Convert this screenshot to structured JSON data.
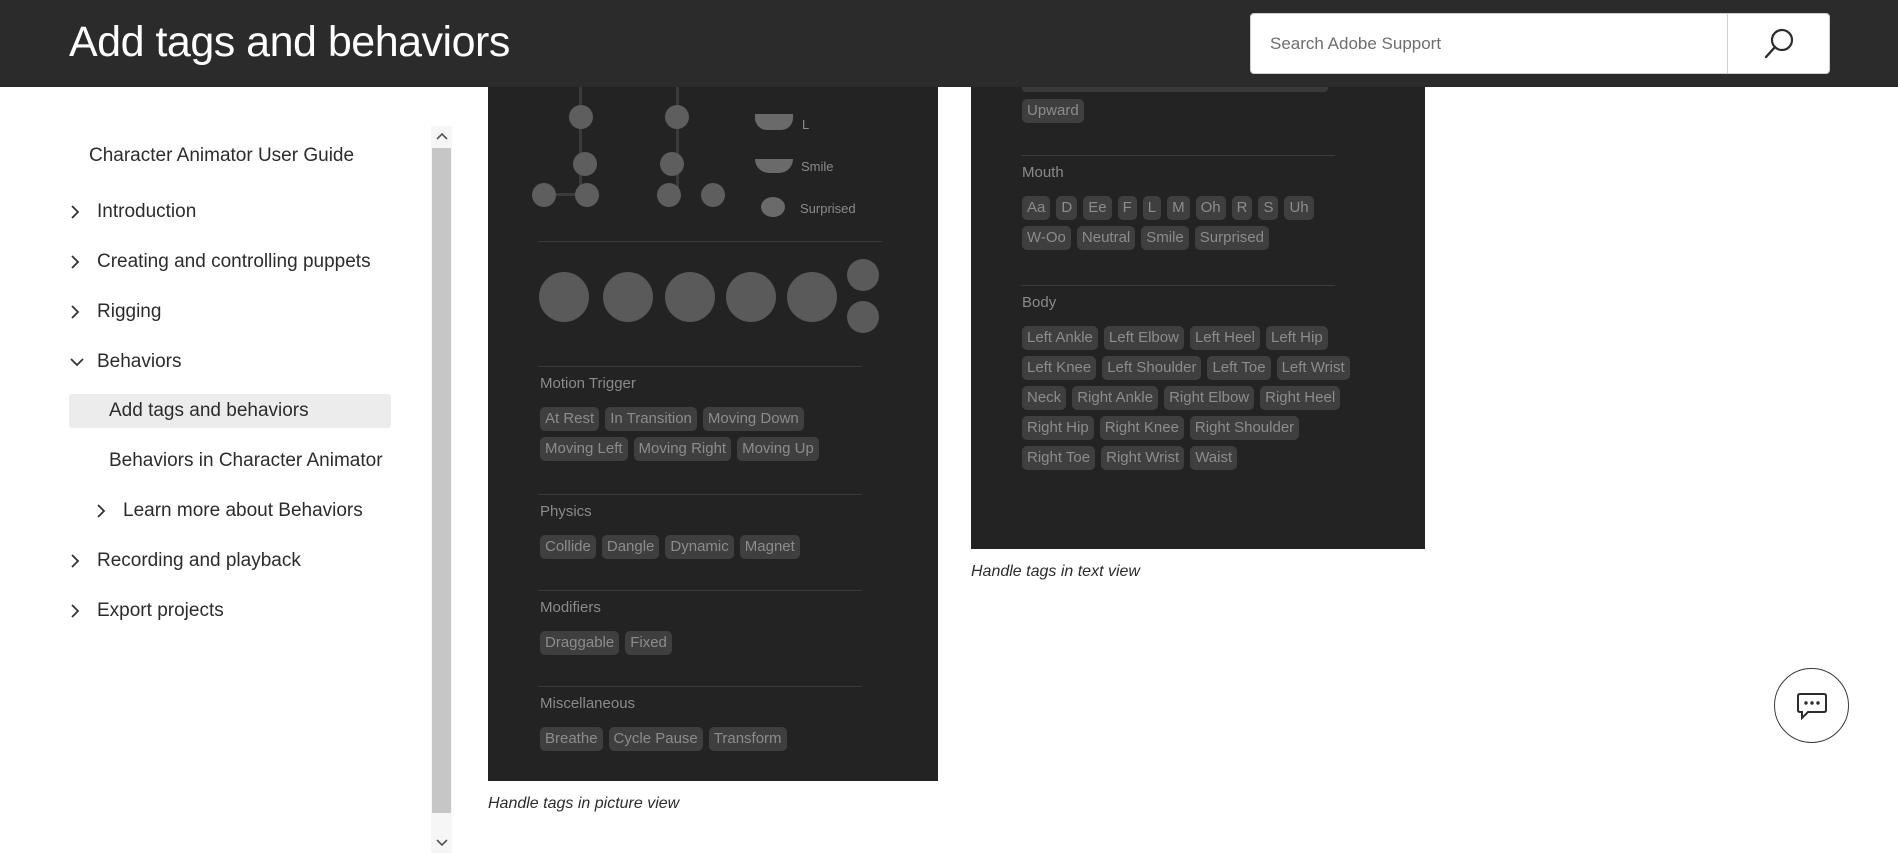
{
  "header": {
    "title": "Add tags and behaviors",
    "search_placeholder": "Search Adobe Support",
    "search_icon": "search-icon"
  },
  "sidebar": {
    "guide_title": "Character Animator User Guide",
    "items": [
      {
        "label": "Introduction",
        "icon": "chevron-right-icon"
      },
      {
        "label": "Creating and controlling puppets",
        "icon": "chevron-right-icon"
      },
      {
        "label": "Rigging",
        "icon": "chevron-right-icon"
      },
      {
        "label": "Behaviors",
        "icon": "chevron-down-icon"
      },
      {
        "label": "Recording and playback",
        "icon": "chevron-right-icon"
      },
      {
        "label": "Export projects",
        "icon": "chevron-right-icon"
      }
    ],
    "sub_items": [
      {
        "label": "Add tags and behaviors",
        "active": true
      },
      {
        "label": "Behaviors in Character Animator",
        "active": false
      },
      {
        "label": "Learn more about Behaviors",
        "icon": "chevron-right-icon"
      }
    ]
  },
  "picture_view": {
    "mouth_labels": [
      "L",
      "Smile",
      "Surprised"
    ],
    "sections": [
      {
        "title": "Motion Trigger",
        "tags": [
          "At Rest",
          "In Transition",
          "Moving Down",
          "Moving Left",
          "Moving Right",
          "Moving Up"
        ]
      },
      {
        "title": "Physics",
        "tags": [
          "Collide",
          "Dangle",
          "Dynamic",
          "Magnet"
        ]
      },
      {
        "title": "Modifiers",
        "tags": [
          "Draggable",
          "Fixed"
        ]
      },
      {
        "title": "Miscellaneous",
        "tags": [
          "Breathe",
          "Cycle Pause",
          "Transform"
        ]
      }
    ],
    "caption": "Handle tags in picture view"
  },
  "text_view": {
    "top_tags": [
      "Upward"
    ],
    "sections": [
      {
        "title": "Mouth",
        "tags": [
          "Aa",
          "D",
          "Ee",
          "F",
          "L",
          "M",
          "Oh",
          "R",
          "S",
          "Uh",
          "W-Oo",
          "Neutral",
          "Smile",
          "Surprised"
        ]
      },
      {
        "title": "Body",
        "tags": [
          "Left Ankle",
          "Left Elbow",
          "Left Heel",
          "Left Hip",
          "Left Knee",
          "Left Shoulder",
          "Left Toe",
          "Left Wrist",
          "Neck",
          "Right Ankle",
          "Right Elbow",
          "Right Heel",
          "Right Hip",
          "Right Knee",
          "Right Shoulder",
          "Right Toe",
          "Right Wrist",
          "Waist"
        ]
      }
    ],
    "caption": "Handle tags in text view"
  },
  "chat": {
    "icon": "chat-icon"
  },
  "colors": {
    "header_bg": "#2b2b2b",
    "panel_bg": "#232323",
    "tag_bg": "#3f3f3f",
    "active_nav_bg": "#ececec"
  }
}
